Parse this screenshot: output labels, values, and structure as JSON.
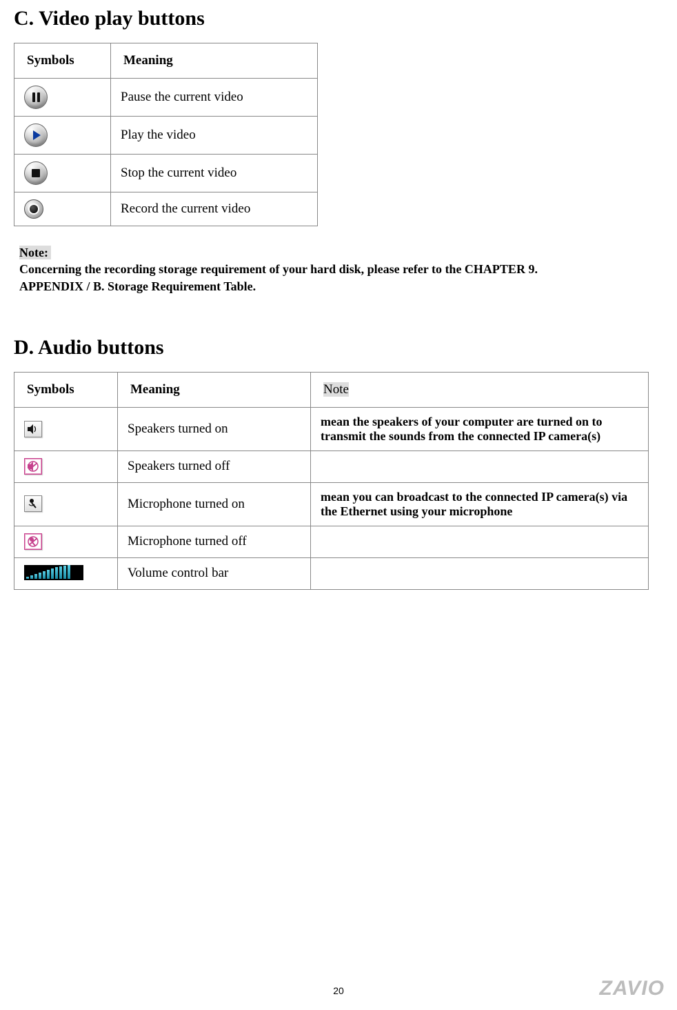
{
  "sectionC": {
    "heading": "C. Video play buttons",
    "headers": {
      "symbols": "Symbols",
      "meaning": "Meaning"
    },
    "rows": [
      {
        "icon": "pause-icon",
        "meaning": "Pause the current video"
      },
      {
        "icon": "play-icon",
        "meaning": "Play the video"
      },
      {
        "icon": "stop-icon",
        "meaning": "Stop the current video"
      },
      {
        "icon": "record-icon",
        "meaning": "Record the current video"
      }
    ]
  },
  "note": {
    "label": "Note:",
    "text": "Concerning the recording storage requirement of your hard disk, please refer to the CHAPTER 9. APPENDIX / B. Storage Requirement Table."
  },
  "sectionD": {
    "heading": "D. Audio buttons",
    "headers": {
      "symbols": "Symbols",
      "meaning": "Meaning",
      "note": "Note"
    },
    "rows": [
      {
        "icon": "speaker-on-icon",
        "meaning": "Speakers turned on",
        "note": "mean the speakers of your computer are turned on to transmit the sounds from the connected IP camera(s)"
      },
      {
        "icon": "speaker-off-icon",
        "meaning": "Speakers turned off",
        "note": ""
      },
      {
        "icon": "mic-on-icon",
        "meaning": "Microphone turned on",
        "note": "mean you can broadcast to the connected IP camera(s) via the Ethernet using your microphone"
      },
      {
        "icon": "mic-off-icon",
        "meaning": "Microphone turned off",
        "note": ""
      },
      {
        "icon": "volume-bar-icon",
        "meaning": "Volume control bar",
        "note": ""
      }
    ]
  },
  "page_number": "20",
  "brand": "ZAVIO"
}
